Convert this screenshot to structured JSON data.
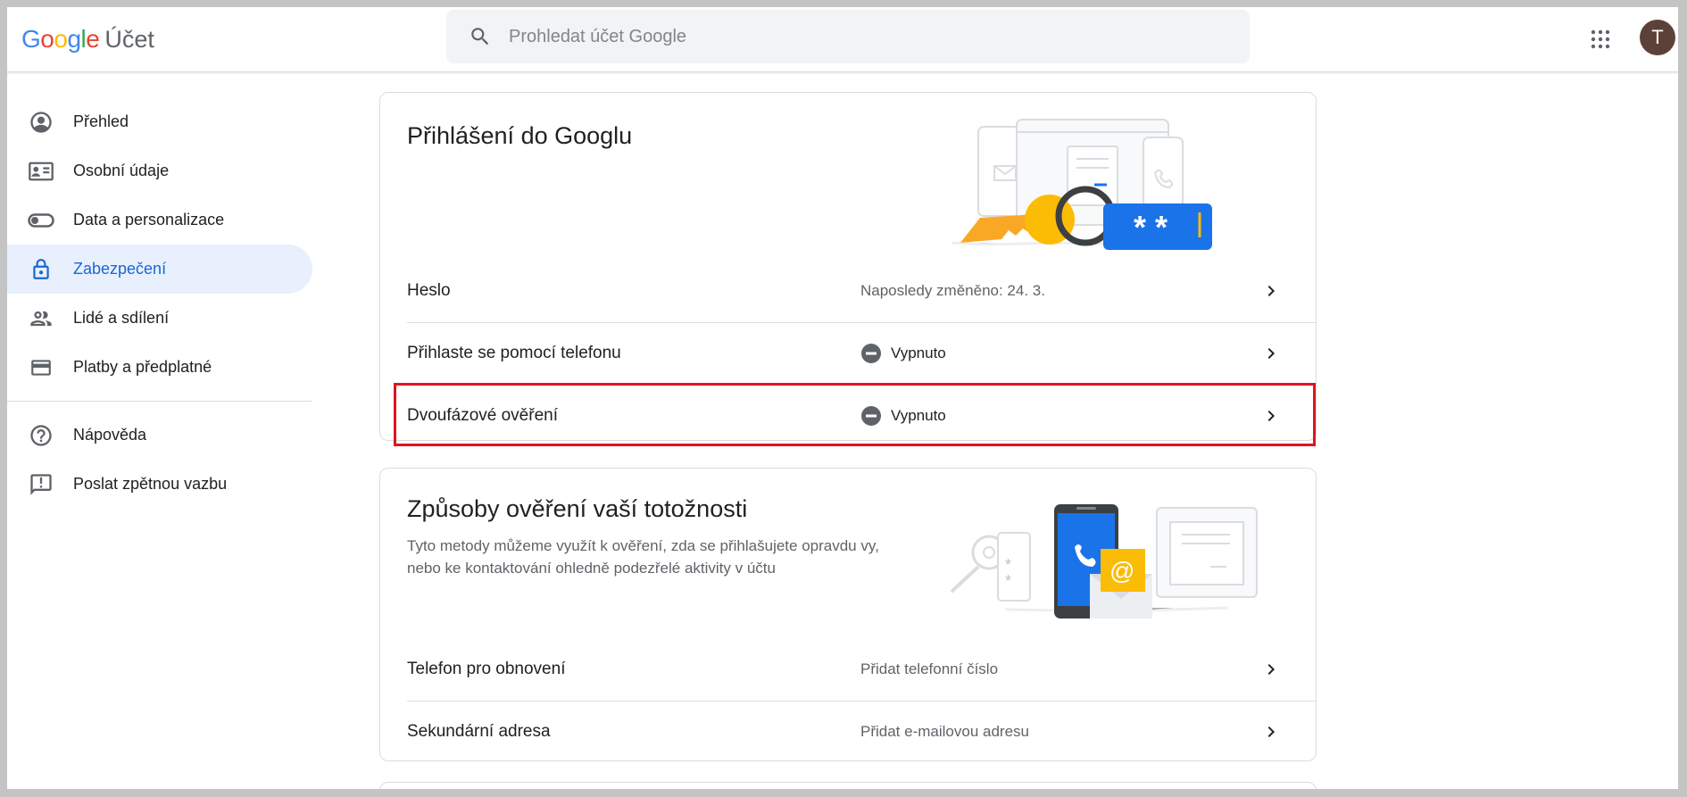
{
  "header": {
    "logo_google": "Google",
    "logo_product": "Účet",
    "search_placeholder": "Prohledat účet Google",
    "avatar_letter": "T"
  },
  "sidebar": {
    "items": [
      {
        "label": "Přehled",
        "icon": "account-circle-icon"
      },
      {
        "label": "Osobní údaje",
        "icon": "id-card-icon"
      },
      {
        "label": "Data a personalizace",
        "icon": "toggle-icon"
      },
      {
        "label": "Zabezpečení",
        "icon": "lock-icon",
        "active": true
      },
      {
        "label": "Lidé a sdílení",
        "icon": "people-icon"
      },
      {
        "label": "Platby a předplatné",
        "icon": "credit-card-icon"
      }
    ],
    "secondary": [
      {
        "label": "Nápověda",
        "icon": "help-icon"
      },
      {
        "label": "Poslat zpětnou vazbu",
        "icon": "feedback-icon"
      }
    ]
  },
  "signin_card": {
    "title": "Přihlášení do Googlu",
    "rows": [
      {
        "label": "Heslo",
        "value": "Naposledy změněno: 24. 3."
      },
      {
        "label": "Přihlaste se pomocí telefonu",
        "value": "Vypnuto",
        "status_icon": "disabled-icon"
      },
      {
        "label": "Dvoufázové ověření",
        "value": "Vypnuto",
        "status_icon": "disabled-icon",
        "highlighted": true
      }
    ]
  },
  "verify_card": {
    "title": "Způsoby ověření vaší totožnosti",
    "description": "Tyto metody můžeme využít k ověření, zda se přihlašujete opravdu vy, nebo ke kontaktování ohledně podezřelé aktivity v účtu",
    "rows": [
      {
        "label": "Telefon pro obnovení",
        "value": "Přidat telefonní číslo"
      },
      {
        "label": "Sekundární adresa",
        "value": "Přidat e-mailovou adresu"
      }
    ]
  },
  "colors": {
    "accent": "#1967d2",
    "active_bg": "#e8f0fe",
    "highlight_border": "#e0141e",
    "google_blue": "#4285f4",
    "google_red": "#ea4335",
    "google_yellow": "#fbbc05",
    "google_green": "#34a853"
  }
}
